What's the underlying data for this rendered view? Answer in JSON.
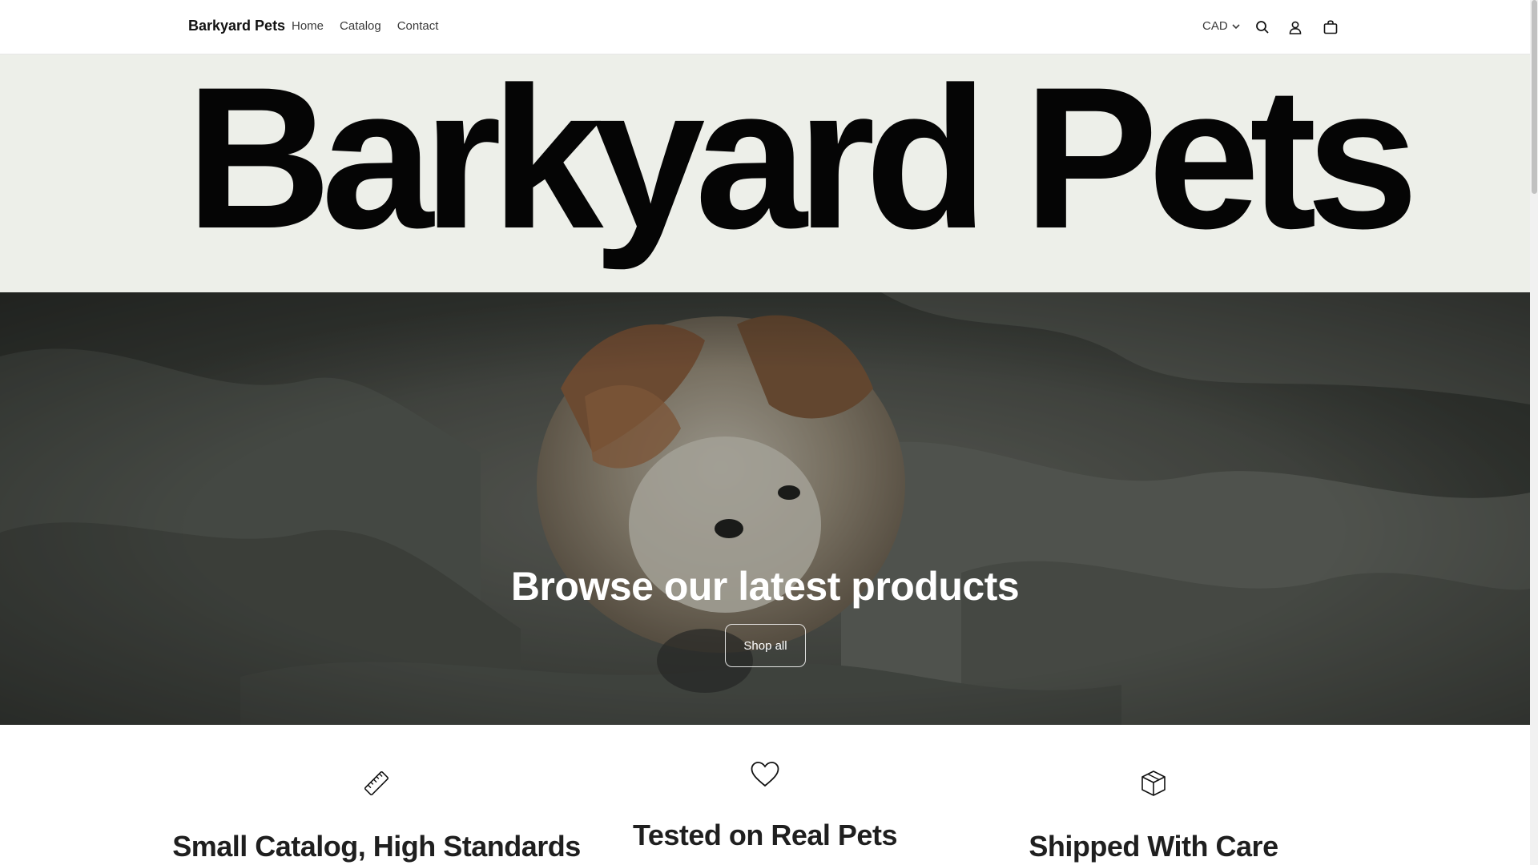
{
  "header": {
    "brand": "Barkyard Pets",
    "nav": [
      "Home",
      "Catalog",
      "Contact"
    ],
    "currency": "CAD",
    "icons": [
      "search-icon",
      "account-icon",
      "cart-icon"
    ]
  },
  "hero": {
    "title": "Barkyard Pets"
  },
  "banner": {
    "heading": "Browse our latest products",
    "button": "Shop all"
  },
  "features": [
    {
      "icon": "ruler-icon",
      "title": "Small Catalog, High Standards"
    },
    {
      "icon": "heart-icon",
      "title": "Tested on Real Pets"
    },
    {
      "icon": "box-icon",
      "title": "Shipped With Care"
    }
  ],
  "colors": {
    "hero_bg": "#edefe9",
    "text": "#121212",
    "banner_overlay": "#4a4d48"
  }
}
